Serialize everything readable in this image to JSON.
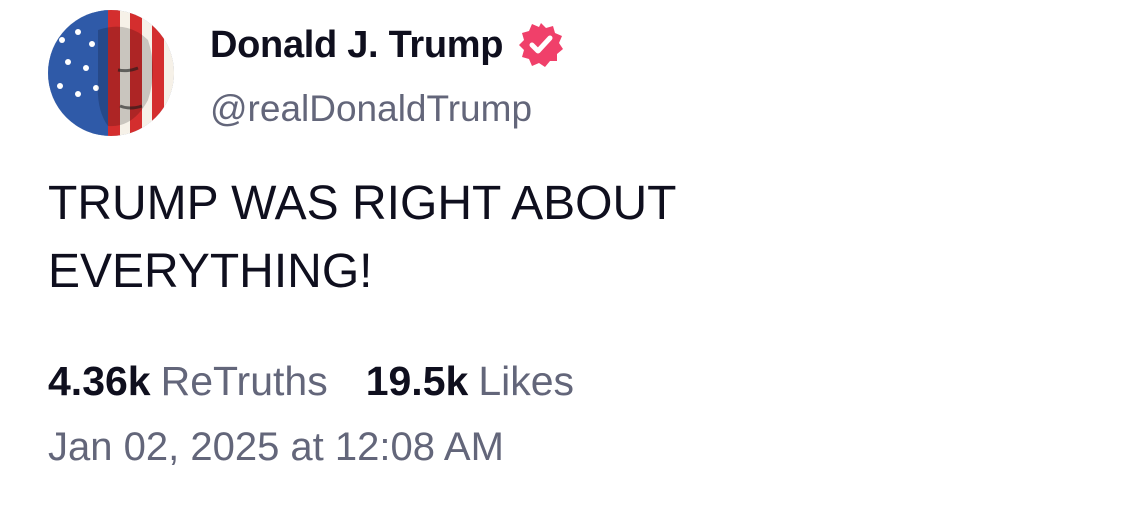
{
  "author": {
    "display_name": "Donald J. Trump",
    "handle": "@realDonaldTrump",
    "verified_icon": "verified-badge-icon",
    "avatar_icon": "profile-avatar"
  },
  "post": {
    "text_lines": [
      "TRUMP WAS RIGHT ABOUT",
      "EVERYTHING!"
    ]
  },
  "stats": {
    "retruths_count": "4.36k",
    "retruths_label": "ReTruths",
    "likes_count": "19.5k",
    "likes_label": "Likes"
  },
  "timestamp": "Jan 02, 2025 at 12:08 AM",
  "colors": {
    "text_primary": "#0f0f1e",
    "text_secondary": "#63667a",
    "verified_badge": "#f0406a",
    "background": "#ffffff"
  }
}
